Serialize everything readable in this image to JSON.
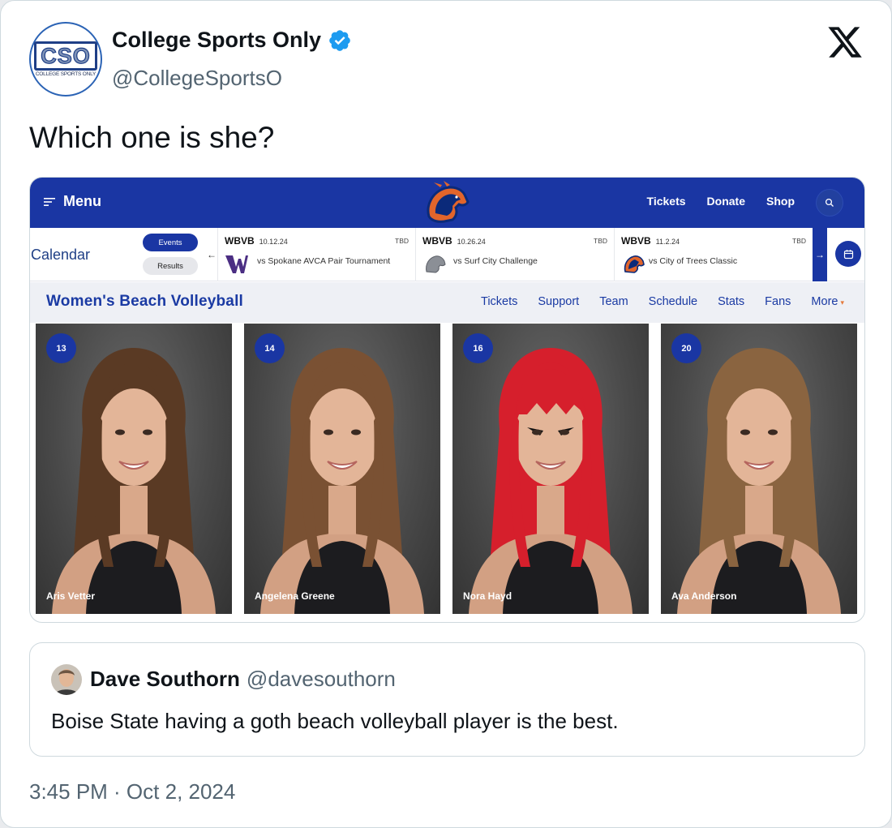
{
  "tweet": {
    "avatar": {
      "logo_text": "CSO",
      "logo_subtext": "COLLEGE SPORTS ONLY"
    },
    "display_name": "College Sports Only",
    "verified": true,
    "handle": "@CollegeSportsO",
    "text": "Which one is she?",
    "timestamp": "3:45 PM · Oct 2, 2024",
    "platform_icon": "x-logo-icon"
  },
  "screenshot": {
    "topbar": {
      "menu_label": "Menu",
      "links": [
        "Tickets",
        "Donate",
        "Shop"
      ]
    },
    "calendar": {
      "label": "Calendar",
      "events_label": "Events",
      "results_label": "Results",
      "events": [
        {
          "tag": "WBVB",
          "date": "10.12.24",
          "status": "TBD",
          "opponent": "vs Spokane AVCA Pair Tournament",
          "logo": "w-logo"
        },
        {
          "tag": "WBVB",
          "date": "10.26.24",
          "status": "TBD",
          "opponent": "vs Surf City Challenge",
          "logo": "gray-bronco-logo"
        },
        {
          "tag": "WBVB",
          "date": "11.2.24",
          "status": "TBD",
          "opponent": "vs City of Trees Classic",
          "logo": "bronco-logo"
        }
      ]
    },
    "subnav": {
      "sport_title": "Women's Beach Volleyball",
      "links": [
        "Tickets",
        "Support",
        "Team",
        "Schedule",
        "Stats",
        "Fans"
      ],
      "more_label": "More"
    },
    "players": [
      {
        "number": "13",
        "name": "Aris Vetter",
        "hair": "#5a3a24"
      },
      {
        "number": "14",
        "name": "Angelena Greene",
        "hair": "#7a5133"
      },
      {
        "number": "16",
        "name": "Nora Hayd",
        "hair": "#d61f2c"
      },
      {
        "number": "20",
        "name": "Ava Anderson",
        "hair": "#8a6440"
      }
    ]
  },
  "quoted_tweet": {
    "display_name": "Dave Southorn",
    "handle": "@davesouthorn",
    "text": "Boise State having a goth beach volleyball player is the best."
  },
  "colors": {
    "brand_blue": "#1a36a3",
    "verified_blue": "#1d9bf0",
    "bronco_orange": "#e2652b"
  }
}
